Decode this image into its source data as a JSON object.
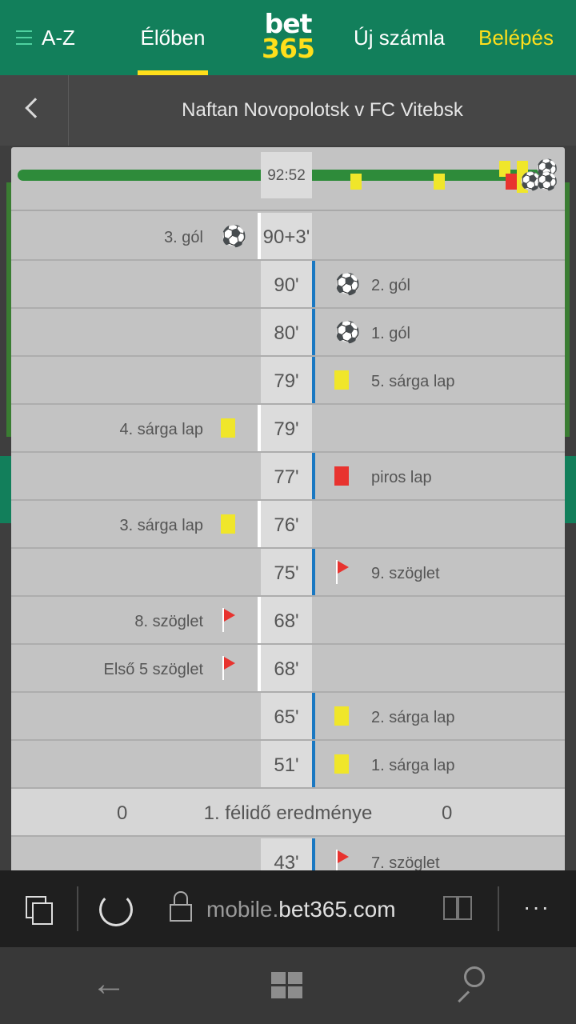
{
  "nav": {
    "menu_label": "A-Z",
    "live_label": "Élőben",
    "logo_top": "bet",
    "logo_bottom": "365",
    "register_label": "Új számla",
    "login_label": "Belépés"
  },
  "match": {
    "title": "Naftan Novopolotsk v FC Vitebsk"
  },
  "summary": {
    "clock": "92:52"
  },
  "events": [
    {
      "minute": "90+3'",
      "side": "left",
      "type": "goal",
      "label": "3. gól"
    },
    {
      "minute": "90'",
      "side": "right",
      "type": "goal",
      "label": "2. gól"
    },
    {
      "minute": "80'",
      "side": "right",
      "type": "goal",
      "label": "1. gól"
    },
    {
      "minute": "79'",
      "side": "right",
      "type": "yellow",
      "label": "5. sárga lap"
    },
    {
      "minute": "79'",
      "side": "left",
      "type": "yellow",
      "label": "4. sárga lap"
    },
    {
      "minute": "77'",
      "side": "right",
      "type": "red",
      "label": "piros lap"
    },
    {
      "minute": "76'",
      "side": "left",
      "type": "yellow",
      "label": "3. sárga lap"
    },
    {
      "minute": "75'",
      "side": "right",
      "type": "corner",
      "label": "9. szöglet"
    },
    {
      "minute": "68'",
      "side": "left",
      "type": "corner",
      "label": "8. szöglet"
    },
    {
      "minute": "68'",
      "side": "left",
      "type": "corner",
      "label": "Első 5 szöglet"
    },
    {
      "minute": "65'",
      "side": "right",
      "type": "yellow",
      "label": "2. sárga lap"
    },
    {
      "minute": "51'",
      "side": "right",
      "type": "yellow",
      "label": "1. sárga lap"
    }
  ],
  "half_time": {
    "home": "0",
    "label": "1. félidő eredménye",
    "away": "0"
  },
  "events_after": [
    {
      "minute": "43'",
      "side": "right",
      "type": "corner",
      "label": "7. szöglet"
    }
  ],
  "browser": {
    "url_prefix": "mobile.",
    "url_domain": "bet365.com",
    "more_label": "···"
  },
  "colors": {
    "brand_green": "#127f5b",
    "brand_yellow": "#ffdf1b",
    "yellow_card": "#f0e62a",
    "red_card": "#e8332f",
    "away_line": "#1a78c2"
  }
}
